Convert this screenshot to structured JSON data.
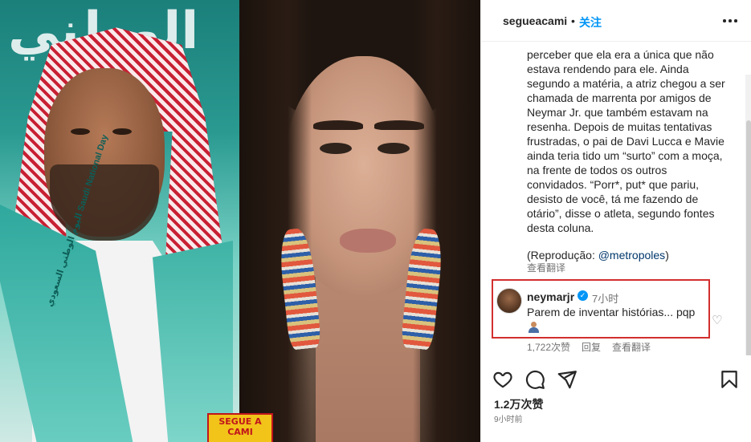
{
  "media": {
    "background_text": "الوطني",
    "sash_text": "اليوم الوطني السعودي Saudi National Day",
    "logo_text": "SEGUE A CAMI"
  },
  "header": {
    "username": "segueacami",
    "separator": "•",
    "follow_label": "关注"
  },
  "caption": {
    "text": "perceber que ela era a única que não estava rendendo para ele. Ainda segundo a matéria, a atriz chegou a ser chamada de marrenta por amigos de Neymar Jr. que também estavam na resenha. Depois de muitas tentativas frustradas, o pai de Davi Lucca e Mavie ainda teria tido um “surto” com a moça, na frente de todos os outros convidados. “Porr*, put* que pariu, desisto de você, tá me fazendo de otário”, disse o atleta, segundo fontes desta coluna.",
    "source_prefix": "(Reprodução: ",
    "source_mention": "@metropoles",
    "source_suffix": ")",
    "translate_label": "查看翻译"
  },
  "comment": {
    "username": "neymarjr",
    "verified_mark": "✓",
    "time": "7小时",
    "text": "Parem de inventar histórias... pqp",
    "emoji": "person-emoji",
    "heart": "♡",
    "likes": "1,722次赞",
    "reply_label": "回复",
    "translate_label": "查看翻译"
  },
  "footer": {
    "likes": "1.2万次赞",
    "time": "9小时前"
  },
  "colors": {
    "link_blue": "#0095f6",
    "mention": "#00376b",
    "highlight_border": "#d32f2f",
    "muted": "#737373"
  },
  "icons": [
    "more-icon",
    "heart-icon",
    "comment-icon",
    "share-icon",
    "bookmark-icon",
    "verified-icon"
  ]
}
